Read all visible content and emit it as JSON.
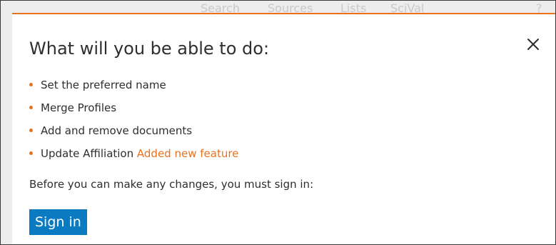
{
  "background_nav": {
    "items": [
      "Search",
      "Sources",
      "Lists",
      "SciVal"
    ],
    "trailing": "?"
  },
  "modal": {
    "title": "What will you be able to do:",
    "close_icon": "close-icon",
    "items": [
      {
        "text": "Set the preferred name"
      },
      {
        "text": "Merge Profiles"
      },
      {
        "text": "Add and remove documents"
      },
      {
        "text": "Update Affiliation",
        "badge": "Added new feature"
      }
    ],
    "note": "Before you can make any changes, you must sign in:",
    "signin_label": "Sign in"
  },
  "colors": {
    "accent": "#e9711c",
    "button": "#0a7bc1",
    "text": "#2e2e2e"
  }
}
